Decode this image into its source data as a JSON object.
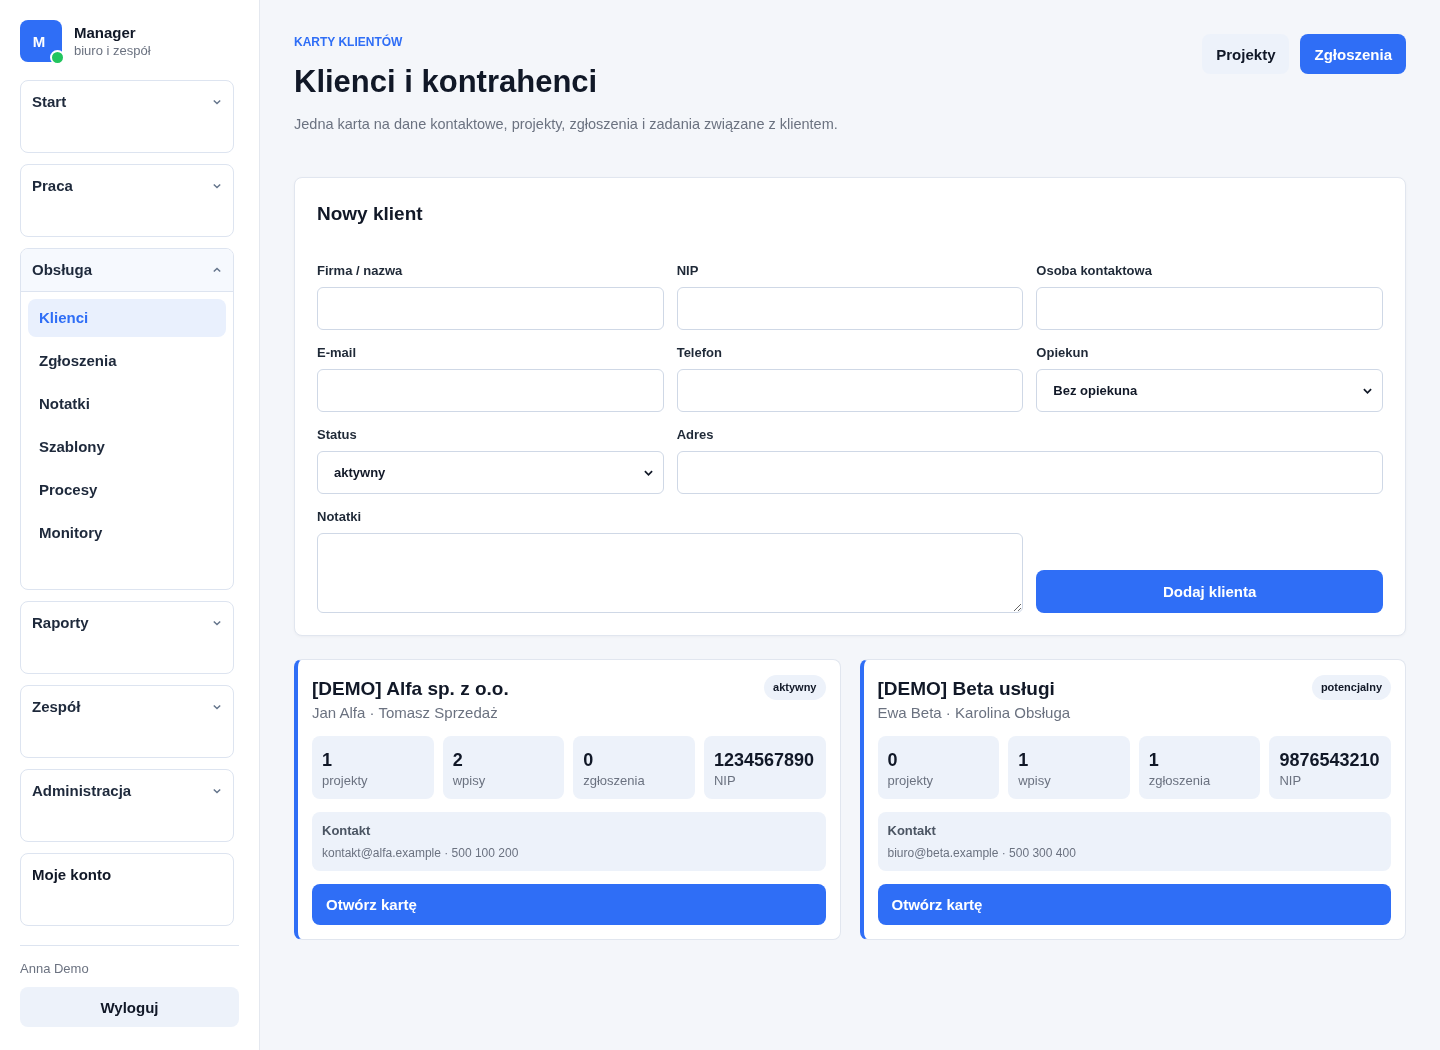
{
  "brand": {
    "logo_letter": "M",
    "name": "Manager",
    "subtitle": "biuro i zespół"
  },
  "sidebar": {
    "groups": [
      {
        "kind": "group",
        "label": "Start",
        "expanded": false
      },
      {
        "kind": "group",
        "label": "Praca",
        "expanded": false
      },
      {
        "kind": "group",
        "label": "Obsługa",
        "expanded": true,
        "items": [
          {
            "label": "Klienci",
            "selected": true
          },
          {
            "label": "Zgłoszenia",
            "selected": false
          },
          {
            "label": "Notatki",
            "selected": false
          },
          {
            "label": "Szablony",
            "selected": false
          },
          {
            "label": "Procesy",
            "selected": false
          },
          {
            "label": "Monitory",
            "selected": false
          }
        ]
      },
      {
        "kind": "group",
        "label": "Raporty",
        "expanded": false
      },
      {
        "kind": "group",
        "label": "Zespół",
        "expanded": false
      },
      {
        "kind": "group",
        "label": "Administracja",
        "expanded": false
      },
      {
        "kind": "link",
        "label": "Moje konto"
      }
    ],
    "user": "Anna Demo",
    "logout": "Wyloguj"
  },
  "header": {
    "eyebrow": "KARTY KLIENTÓW",
    "title": "Klienci i kontrahenci",
    "subtitle": "Jedna karta na dane kontaktowe, projekty, zgłoszenia i zadania związane z klientem.",
    "actions": [
      {
        "kind": "secondary",
        "label": "Projekty"
      },
      {
        "kind": "primary",
        "label": "Zgłoszenia"
      }
    ]
  },
  "form": {
    "title": "Nowy klient",
    "fields": [
      {
        "kind": "text",
        "label": "Firma / nazwa"
      },
      {
        "kind": "text",
        "label": "NIP"
      },
      {
        "kind": "text",
        "label": "Osoba kontaktowa"
      },
      {
        "kind": "text",
        "label": "E-mail"
      },
      {
        "kind": "text",
        "label": "Telefon"
      },
      {
        "kind": "select",
        "label": "Opiekun",
        "value": "Bez opiekuna"
      },
      {
        "kind": "select",
        "label": "Status",
        "value": "aktywny"
      },
      {
        "kind": "text",
        "label": "Adres"
      },
      {
        "kind": "textarea",
        "label": "Notatki"
      }
    ],
    "submit": "Dodaj klienta"
  },
  "clients": [
    {
      "name": "[DEMO] Alfa sp. z o.o.",
      "people": "Jan Alfa · Tomasz Sprzedaż",
      "status": "aktywny",
      "stats": [
        {
          "value": "1",
          "label": "projekty"
        },
        {
          "value": "2",
          "label": "wpisy"
        },
        {
          "value": "0",
          "label": "zgłoszenia"
        },
        {
          "value": "1234567890",
          "label": "NIP"
        }
      ],
      "contact": {
        "label": "Kontakt",
        "details": "kontakt@alfa.example · 500 100 200"
      },
      "button": "Otwórz kartę"
    },
    {
      "name": "[DEMO] Beta usługi",
      "people": "Ewa Beta · Karolina Obsługa",
      "status": "potencjalny",
      "stats": [
        {
          "value": "0",
          "label": "projekty"
        },
        {
          "value": "1",
          "label": "wpisy"
        },
        {
          "value": "1",
          "label": "zgłoszenia"
        },
        {
          "value": "9876543210",
          "label": "NIP"
        }
      ],
      "contact": {
        "label": "Kontakt",
        "details": "biuro@beta.example · 500 300 400"
      },
      "button": "Otwórz kartę"
    }
  ]
}
